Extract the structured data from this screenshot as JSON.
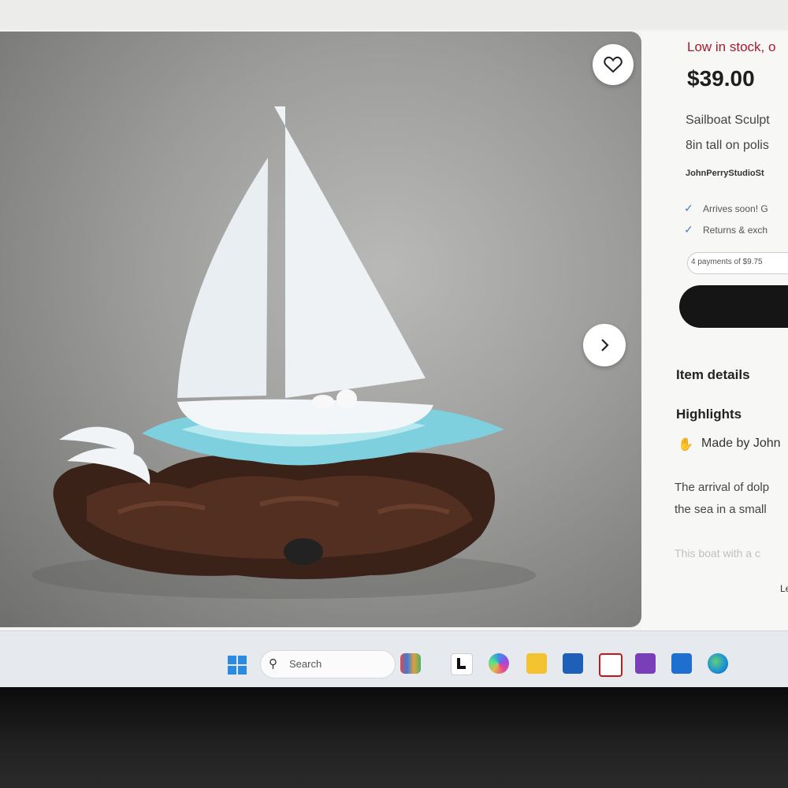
{
  "product": {
    "stock": "Low in stock, o",
    "price": "$39.00",
    "title_line1": "Sailboat Sculpt",
    "title_line2": "8in tall on polis",
    "shop": "JohnPerryStudioSt",
    "perks": [
      "Arrives soon! G",
      "Returns & exch"
    ],
    "payments": "4 payments of $9.75"
  },
  "details": {
    "item_details": "Item details",
    "highlights": "Highlights",
    "made_by": "Made by John",
    "desc_line1": "The arrival of dolp",
    "desc_line2": "the sea in a small",
    "desc_line3": "This boat with a c",
    "more": "Le"
  },
  "taskbar": {
    "search_label": "Search"
  },
  "colors": {
    "stock_red": "#a61a2e",
    "check_blue": "#4a7fc1",
    "cart_button": "#151515"
  },
  "icons": [
    "heart-icon",
    "chevron-right-icon",
    "checkmark-icon",
    "hand-icon",
    "windows-start-icon",
    "search-icon"
  ]
}
